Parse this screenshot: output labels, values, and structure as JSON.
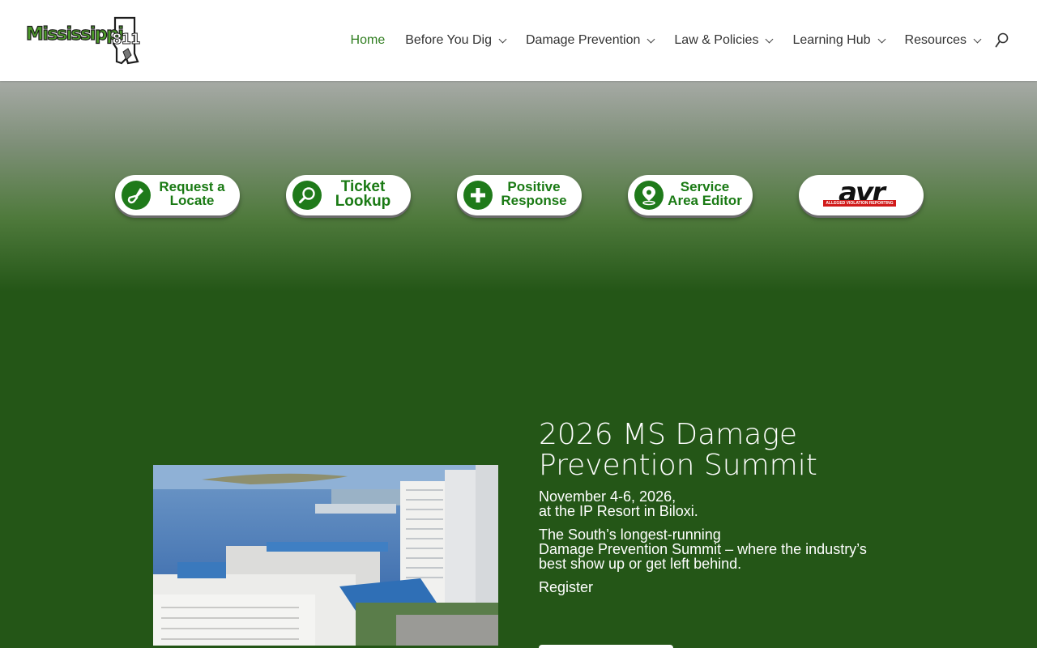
{
  "header": {
    "logo": {
      "text": "Mississippi",
      "number": "811"
    },
    "nav": [
      {
        "label": "Home",
        "active": true,
        "has_dropdown": false
      },
      {
        "label": "Before You Dig",
        "active": false,
        "has_dropdown": true
      },
      {
        "label": "Damage Prevention",
        "active": false,
        "has_dropdown": true
      },
      {
        "label": "Law & Policies",
        "active": false,
        "has_dropdown": true
      },
      {
        "label": "Learning Hub",
        "active": false,
        "has_dropdown": true
      },
      {
        "label": "Resources",
        "active": false,
        "has_dropdown": true
      }
    ],
    "search_icon": "search-icon"
  },
  "quick_links": [
    {
      "line1": "Request a",
      "line2": "Locate",
      "icon": "shovel-icon"
    },
    {
      "line1": "Ticket",
      "line2": "Lookup",
      "icon": "magnifier-icon"
    },
    {
      "line1": "Positive",
      "line2": "Response",
      "icon": "plus-icon"
    },
    {
      "line1": "Service",
      "line2": "Area Editor",
      "icon": "map-pin-icon"
    },
    {
      "brand": "avr",
      "tagline": "ALLEGED VIOLATION REPORTING"
    }
  ],
  "event": {
    "title_line1": "2026 MS Damage",
    "title_line2": "Prevention Summit",
    "date_line1": "November 4-6, 2026,",
    "date_line2": "at the IP Resort in Biloxi.",
    "desc_line1": "The South’s longest-running",
    "desc_line2": "Damage Prevention Summit – where the industry’s",
    "desc_line3": "best show up or get left behind.",
    "link": "Register"
  },
  "colors": {
    "brand_green": "#2f7d1f",
    "background_green": "#245617",
    "button_green": "#1f7a1a",
    "avr_red": "#d11a1a"
  }
}
